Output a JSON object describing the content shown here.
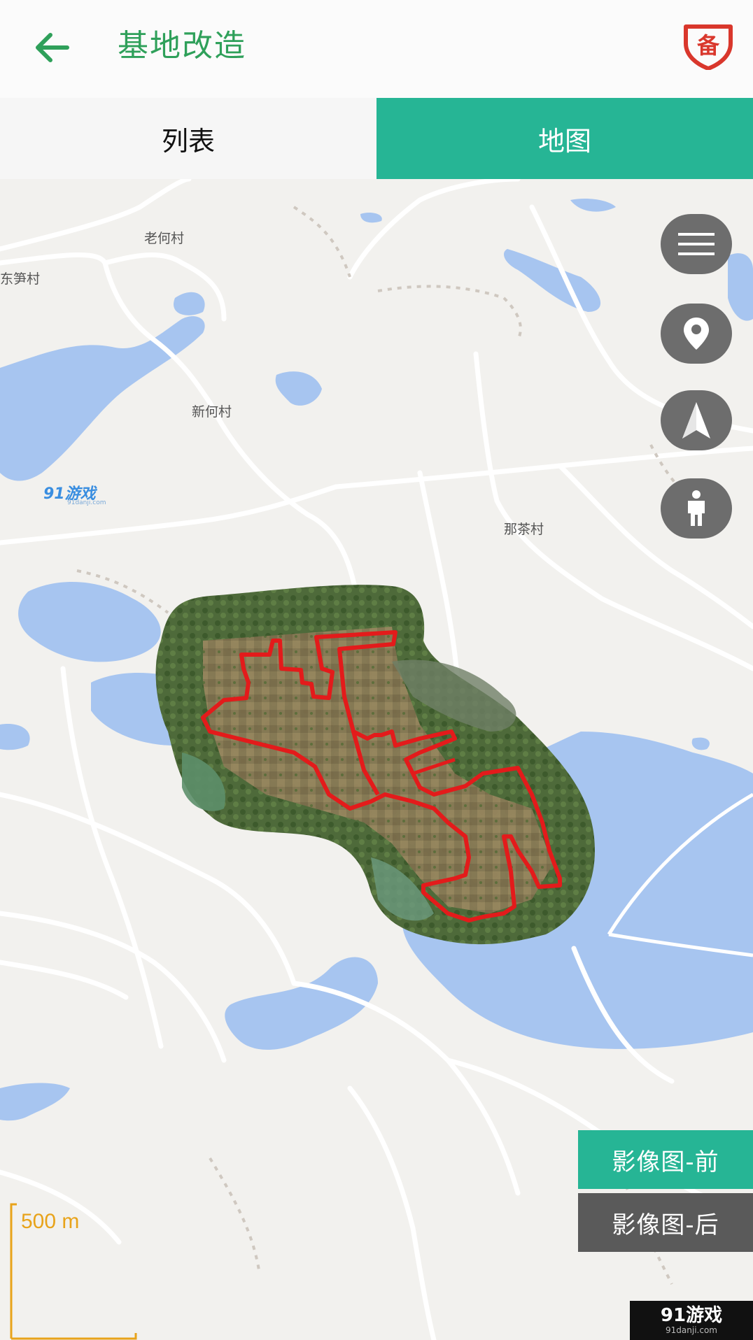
{
  "header": {
    "title": "基地改造",
    "back_icon": "arrow-left-icon",
    "badge_icon": "shield-bei-icon",
    "badge_text": "备",
    "accent_color": "#2fa05a",
    "badge_color": "#d9372c"
  },
  "tabs": [
    {
      "label": "列表",
      "active": false
    },
    {
      "label": "地图",
      "active": true
    }
  ],
  "tab_active_color": "#26b595",
  "map": {
    "place_labels": [
      "老何村",
      "东笋村",
      "新何村",
      "那茶村"
    ],
    "watermark": "91游戏",
    "watermark_sub": "91danji.com",
    "scale_label": "500 m",
    "controls": [
      {
        "name": "menu",
        "icon": "menu-icon"
      },
      {
        "name": "location",
        "icon": "location-pin-icon"
      },
      {
        "name": "navigation",
        "icon": "navigation-arrow-icon"
      },
      {
        "name": "person",
        "icon": "person-icon"
      }
    ],
    "image_buttons": {
      "before": "影像图-前",
      "after": "影像图-后"
    }
  },
  "corner_watermark": {
    "main": "91游戏",
    "sub": "91danji.com"
  }
}
